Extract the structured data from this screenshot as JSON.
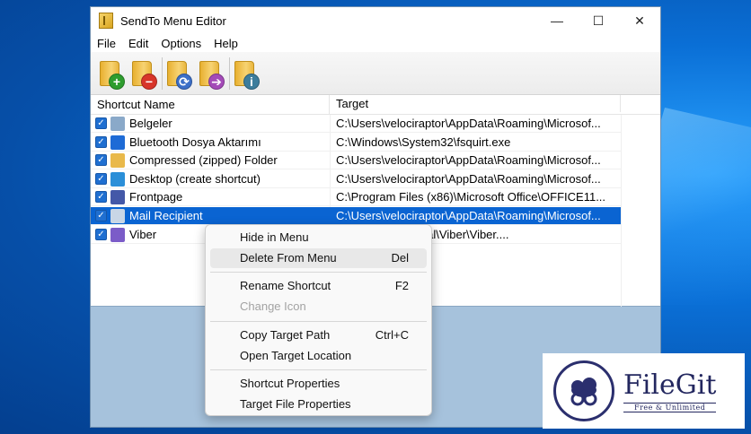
{
  "window": {
    "title": "SendTo Menu Editor",
    "caption": {
      "minimize": "—",
      "maximize": "☐",
      "close": "✕"
    }
  },
  "menubar": [
    "File",
    "Edit",
    "Options",
    "Help"
  ],
  "toolbar": [
    {
      "icon": "add-folder-icon",
      "badge": "+",
      "color": "#2e9d2e"
    },
    {
      "icon": "remove-folder-icon",
      "badge": "−",
      "color": "#d8352a"
    },
    {
      "icon": "refresh-folder-icon",
      "badge": "⟳",
      "color": "#3c6fc8"
    },
    {
      "icon": "send-folder-icon",
      "badge": "➔",
      "color": "#a44ab8"
    },
    {
      "icon": "info-folder-icon",
      "badge": "i",
      "color": "#3d7d9c"
    }
  ],
  "list": {
    "columns": [
      "Shortcut Name",
      "Target"
    ],
    "rows": [
      {
        "name": "Belgeler",
        "target": "C:\\Users\\velociraptor\\AppData\\Roaming\\Microsof...",
        "icon": "document-icon",
        "icon_color": "#8aa9c9",
        "checked": true,
        "selected": false
      },
      {
        "name": "Bluetooth Dosya Aktarımı",
        "target": "C:\\Windows\\System32\\fsquirt.exe",
        "icon": "bluetooth-icon",
        "icon_color": "#1e6bd6",
        "checked": true,
        "selected": false
      },
      {
        "name": "Compressed (zipped) Folder",
        "target": "C:\\Users\\velociraptor\\AppData\\Roaming\\Microsof...",
        "icon": "zip-folder-icon",
        "icon_color": "#e9b94a",
        "checked": true,
        "selected": false
      },
      {
        "name": "Desktop (create shortcut)",
        "target": "C:\\Users\\velociraptor\\AppData\\Roaming\\Microsof...",
        "icon": "desktop-icon",
        "icon_color": "#2b8fd8",
        "checked": true,
        "selected": false
      },
      {
        "name": "Frontpage",
        "target": "C:\\Program Files (x86)\\Microsoft Office\\OFFICE11...",
        "icon": "frontpage-icon",
        "icon_color": "#4458a8",
        "checked": true,
        "selected": false
      },
      {
        "name": "Mail Recipient",
        "target": "C:\\Users\\velociraptor\\AppData\\Roaming\\Microsof...",
        "icon": "mail-icon",
        "icon_color": "#c9d6e6",
        "checked": true,
        "selected": true
      },
      {
        "name": "Viber",
        "target": "ptor\\AppData\\Local\\Viber\\Viber....",
        "icon": "viber-icon",
        "icon_color": "#7b5cc8",
        "checked": true,
        "selected": false
      }
    ]
  },
  "context_menu": {
    "items": [
      {
        "label": "Hide in Menu",
        "shortcut": "",
        "disabled": false,
        "hover": false
      },
      {
        "label": "Delete From Menu",
        "shortcut": "Del",
        "disabled": false,
        "hover": true
      },
      {
        "sep": true
      },
      {
        "label": "Rename Shortcut",
        "shortcut": "F2",
        "disabled": false,
        "hover": false
      },
      {
        "label": "Change Icon",
        "shortcut": "",
        "disabled": true,
        "hover": false
      },
      {
        "sep": true
      },
      {
        "label": "Copy Target Path",
        "shortcut": "Ctrl+C",
        "disabled": false,
        "hover": false
      },
      {
        "label": "Open Target Location",
        "shortcut": "",
        "disabled": false,
        "hover": false
      },
      {
        "sep": true
      },
      {
        "label": "Shortcut Properties",
        "shortcut": "",
        "disabled": false,
        "hover": false
      },
      {
        "label": "Target File Properties",
        "shortcut": "",
        "disabled": false,
        "hover": false
      }
    ]
  },
  "watermark": {
    "name": "FileGit",
    "tagline": "Free & Unlimited"
  }
}
